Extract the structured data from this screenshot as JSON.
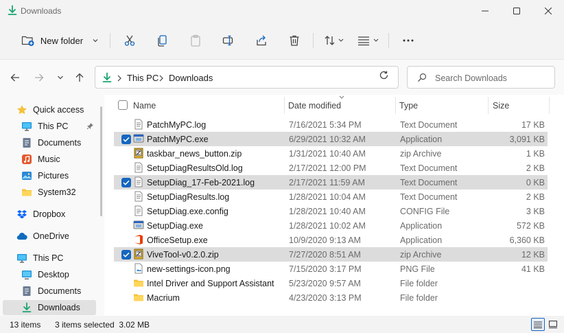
{
  "window": {
    "title": "Downloads"
  },
  "toolbar": {
    "new_folder": "New folder"
  },
  "address": {
    "crumbs": [
      "This PC",
      "Downloads"
    ]
  },
  "search": {
    "placeholder": "Search Downloads"
  },
  "sidebar": {
    "items": [
      {
        "label": "Quick access",
        "icon": "star-icon"
      },
      {
        "label": "This PC",
        "icon": "monitor-icon"
      },
      {
        "label": "Documents",
        "icon": "documents-icon"
      },
      {
        "label": "Music",
        "icon": "music-icon"
      },
      {
        "label": "Pictures",
        "icon": "pictures-icon"
      },
      {
        "label": "System32",
        "icon": "folder-icon"
      },
      {
        "label": "Dropbox",
        "icon": "dropbox-icon"
      },
      {
        "label": "OneDrive",
        "icon": "cloud-icon"
      },
      {
        "label": "This PC",
        "icon": "monitor-icon"
      },
      {
        "label": "Desktop",
        "icon": "desktop-icon"
      },
      {
        "label": "Documents",
        "icon": "documents-icon"
      },
      {
        "label": "Downloads",
        "icon": "download-icon"
      }
    ]
  },
  "columns": {
    "name": "Name",
    "date": "Date modified",
    "type": "Type",
    "size": "Size"
  },
  "files": [
    {
      "name": "PatchMyPC.log",
      "date": "7/16/2021 5:34 PM",
      "type": "Text Document",
      "size": "17 KB",
      "selected": false,
      "icon": "text-file-icon"
    },
    {
      "name": "PatchMyPC.exe",
      "date": "6/29/2021 10:32 AM",
      "type": "Application",
      "size": "3,091 KB",
      "selected": true,
      "icon": "application-icon"
    },
    {
      "name": "taskbar_news_button.zip",
      "date": "1/31/2021 10:40 AM",
      "type": "zip Archive",
      "size": "1 KB",
      "selected": false,
      "icon": "zip-file-icon"
    },
    {
      "name": "SetupDiagResultsOld.log",
      "date": "2/17/2021 12:00 PM",
      "type": "Text Document",
      "size": "2 KB",
      "selected": false,
      "icon": "text-file-icon"
    },
    {
      "name": "SetupDiag_17-Feb-2021.log",
      "date": "2/17/2021 11:59 AM",
      "type": "Text Document",
      "size": "0 KB",
      "selected": true,
      "icon": "text-file-icon"
    },
    {
      "name": "SetupDiagResults.log",
      "date": "1/28/2021 10:04 AM",
      "type": "Text Document",
      "size": "2 KB",
      "selected": false,
      "icon": "text-file-icon"
    },
    {
      "name": "SetupDiag.exe.config",
      "date": "1/28/2021 10:40 AM",
      "type": "CONFIG File",
      "size": "3 KB",
      "selected": false,
      "icon": "config-file-icon"
    },
    {
      "name": "SetupDiag.exe",
      "date": "1/28/2021 10:02 AM",
      "type": "Application",
      "size": "572 KB",
      "selected": false,
      "icon": "application-icon"
    },
    {
      "name": "OfficeSetup.exe",
      "date": "10/9/2020 9:13 AM",
      "type": "Application",
      "size": "6,360 KB",
      "selected": false,
      "icon": "office-icon"
    },
    {
      "name": "ViveTool-v0.2.0.zip",
      "date": "7/27/2020 8:51 AM",
      "type": "zip Archive",
      "size": "12 KB",
      "selected": true,
      "icon": "zip-file-icon"
    },
    {
      "name": "new-settings-icon.png",
      "date": "7/15/2020 3:17 PM",
      "type": "PNG File",
      "size": "41 KB",
      "selected": false,
      "icon": "image-file-icon"
    },
    {
      "name": "Intel Driver and Support Assistant",
      "date": "5/23/2020 9:57 AM",
      "type": "File folder",
      "size": "",
      "selected": false,
      "icon": "folder-icon"
    },
    {
      "name": "Macrium",
      "date": "4/23/2020 3:13 PM",
      "type": "File folder",
      "size": "",
      "selected": false,
      "icon": "folder-icon"
    }
  ],
  "status": {
    "count": "13 items",
    "selection": "3 items selected  3.02 MB"
  },
  "colors": {
    "accent": "#1566c0",
    "folder": "#f4c23a",
    "download": "#1aa56f"
  }
}
